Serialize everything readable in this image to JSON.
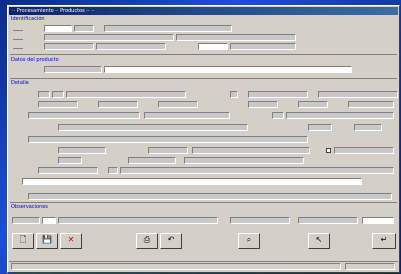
{
  "window": {
    "title": "·· Procesamiento ·· Productos ·· ··"
  },
  "section1": {
    "heading": "Identificación",
    "field_a": "",
    "field_b": "",
    "field_c": "",
    "field_d": "",
    "field_e": "",
    "field_f": "",
    "field_g": "",
    "field_h": ""
  },
  "section2": {
    "heading": "Datos del producto",
    "field_a": ""
  },
  "section3": {
    "heading": "Detalle",
    "rows": [
      "",
      "",
      "",
      "",
      "",
      "",
      "",
      "",
      "",
      ""
    ]
  },
  "section4": {
    "heading": "Observaciones"
  },
  "toolbar": {
    "new_label": "🗋",
    "save_label": "💾",
    "delete_label": "✕",
    "print_label": "⎙",
    "undo_label": "↶",
    "search_label": "⌕",
    "cursor_label": "↖",
    "exit_label": "↵"
  },
  "status": {
    "left": "",
    "right": ""
  },
  "colors": {
    "delete": "#cc0000",
    "accent": "#0000c8"
  }
}
